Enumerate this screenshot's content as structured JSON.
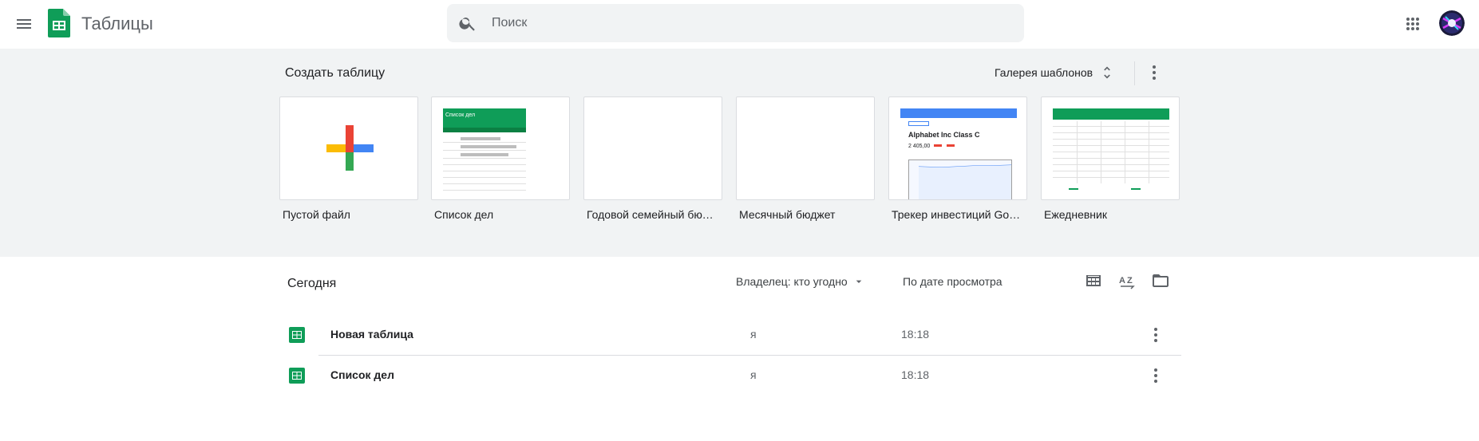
{
  "header": {
    "app_title": "Таблицы",
    "search_placeholder": "Поиск"
  },
  "templates": {
    "heading": "Создать таблицу",
    "gallery_label": "Галерея шаблонов",
    "items": [
      {
        "label": "Пустой файл"
      },
      {
        "label": "Список дел",
        "thumb_title": "Список дел"
      },
      {
        "label": "Годовой семейный бюджет"
      },
      {
        "label": "Месячный бюджет"
      },
      {
        "label": "Трекер инвестиций Google Finance",
        "thumb_title": "Alphabet Inc Class C",
        "thumb_value": "2 405,00"
      },
      {
        "label": "Ежедневник"
      }
    ]
  },
  "files": {
    "section_title": "Сегодня",
    "owner_filter": "Владелец: кто угодно",
    "sort_label": "По дате просмотра",
    "rows": [
      {
        "name": "Новая таблица",
        "owner": "я",
        "date": "18:18"
      },
      {
        "name": "Список дел",
        "owner": "я",
        "date": "18:18"
      }
    ]
  },
  "colors": {
    "sheets_green": "#0f9d58",
    "template_bg": "#f1f3f4",
    "google_red": "#ea4335",
    "google_blue": "#4285f4",
    "google_yellow": "#fbbc04",
    "google_green": "#34a853"
  }
}
